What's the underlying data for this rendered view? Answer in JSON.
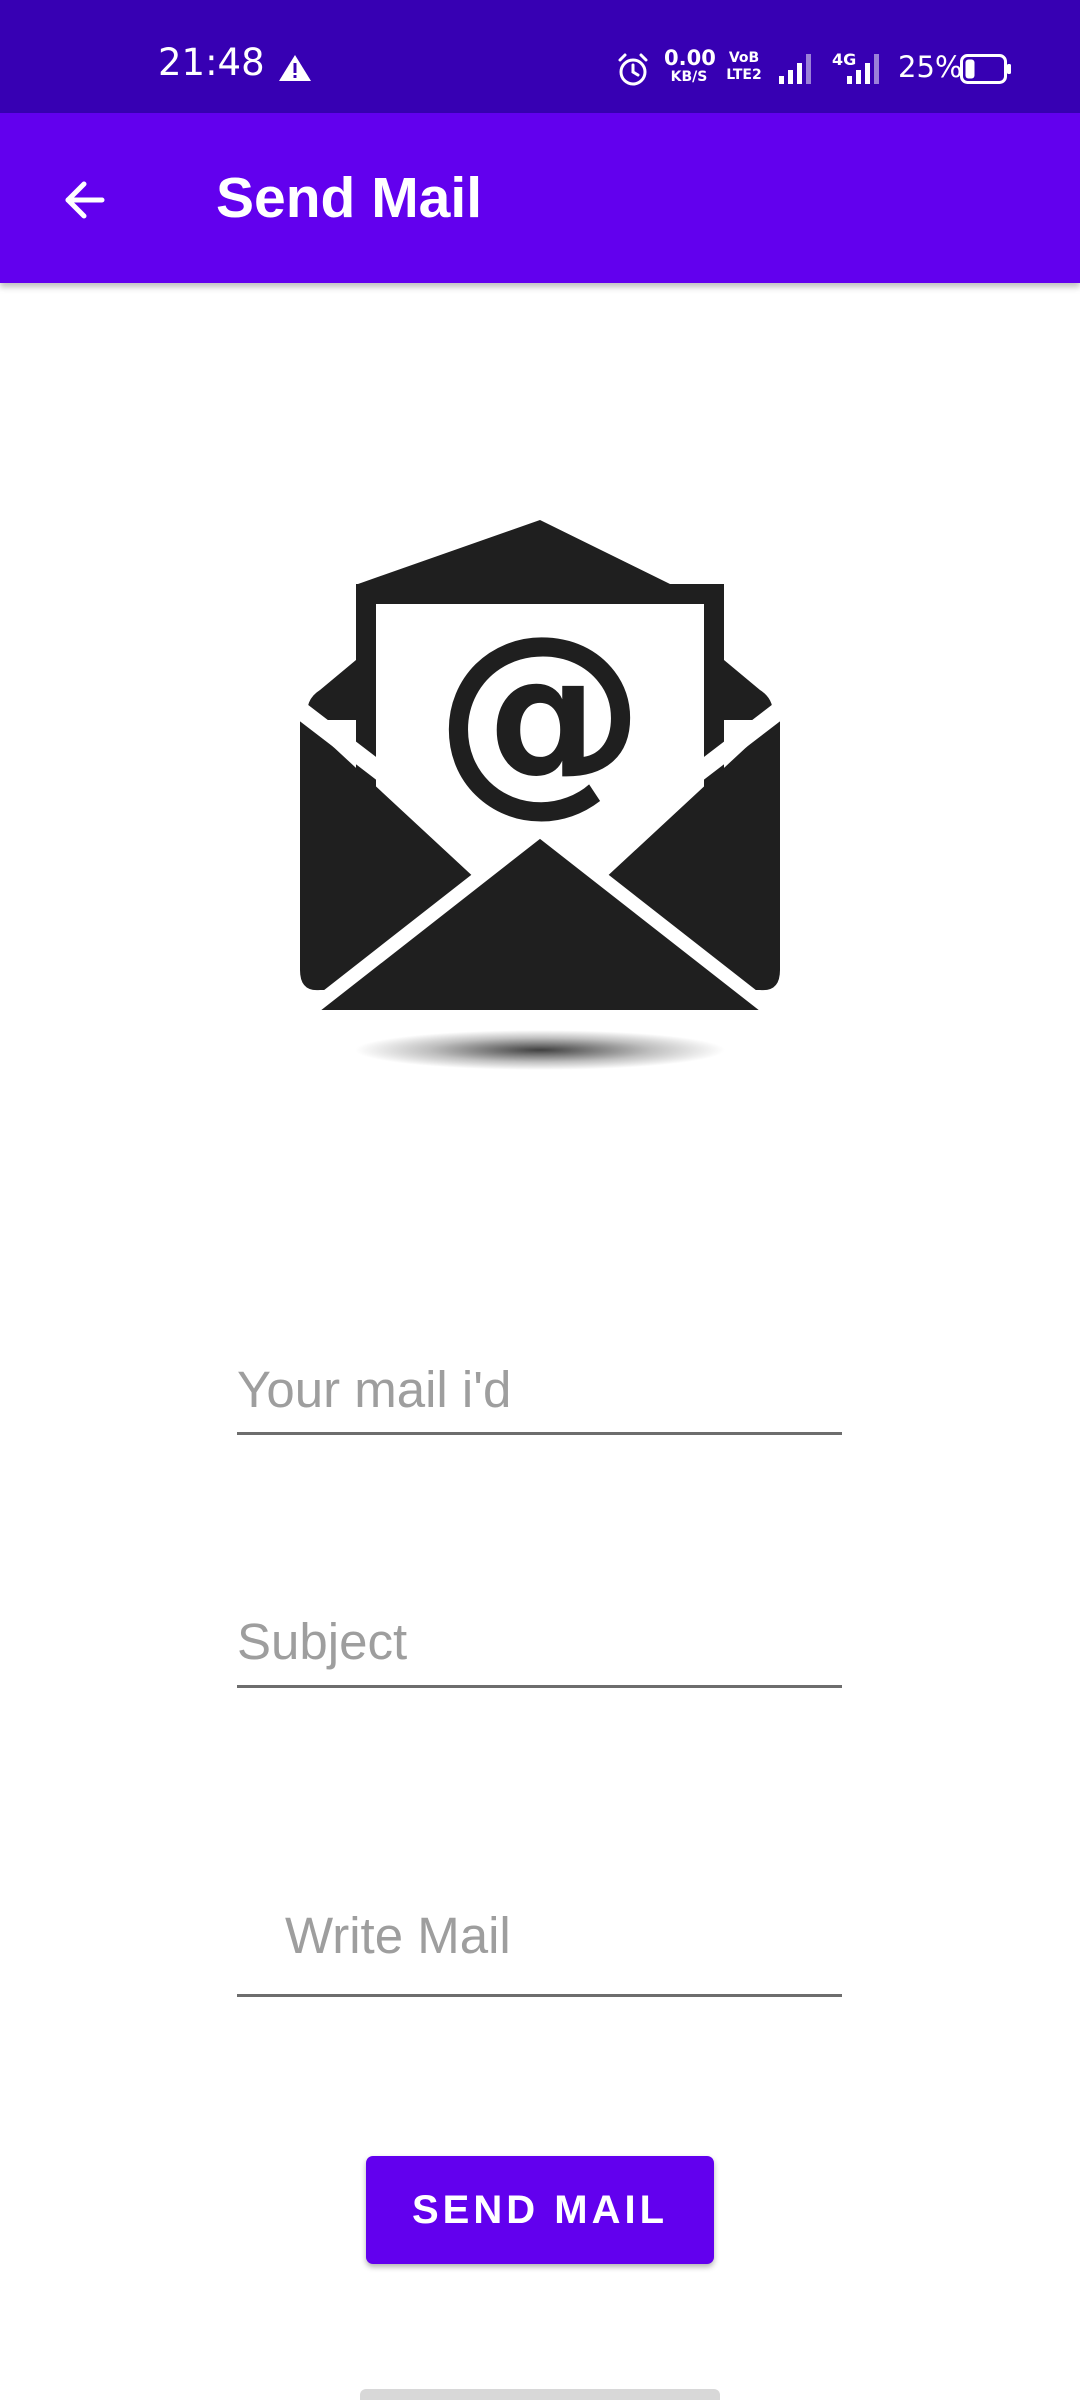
{
  "status_bar": {
    "time": "21:48",
    "net_speed_value": "0.00",
    "net_speed_unit": "KB/S",
    "volte_top": "VoB",
    "volte_bottom": "LTE2",
    "network_type": "4G",
    "battery": "25%",
    "battery_level_percent": 25
  },
  "app_bar": {
    "title": "Send Mail",
    "back_icon": "arrow-back-icon"
  },
  "illustration": {
    "icon": "open-envelope-at-icon",
    "symbol": "@"
  },
  "form": {
    "email_placeholder": "Your mail i'd",
    "email_value": "",
    "subject_placeholder": "Subject",
    "subject_value": "",
    "message_placeholder": "Write Mail",
    "message_value": ""
  },
  "send_button": {
    "label": "SEND MAIL"
  },
  "colors": {
    "status_bar": "#3700b3",
    "primary": "#6200ee",
    "on_primary": "#ffffff",
    "underline": "#6d6d6d",
    "placeholder": "#9e9e9e",
    "envelope": "#1f1f1f"
  }
}
